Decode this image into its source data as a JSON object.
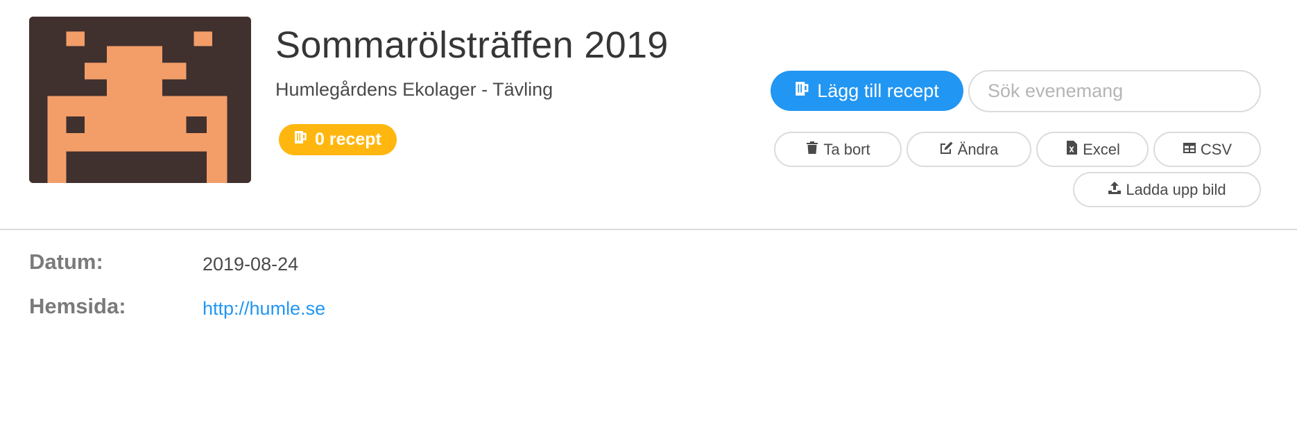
{
  "event": {
    "title": "Sommarölsträffen 2019",
    "subtitle": "Humlegårdens Ekolager - Tävling",
    "recipe_count": "0 recept"
  },
  "actions": {
    "add_recipe": "Lägg till recept",
    "search_placeholder": "Sök evenemang",
    "delete": "Ta bort",
    "edit": "Ändra",
    "excel": "Excel",
    "csv": "CSV",
    "upload_image": "Ladda upp bild"
  },
  "details": {
    "date_label": "Datum:",
    "date_value": "2019-08-24",
    "website_label": "Hemsida:",
    "website_value": "http://humle.se"
  },
  "icons": {
    "badge": "beer-mug-icon",
    "add_recipe": "beer-mug-icon",
    "delete": "trash-icon",
    "edit": "edit-icon",
    "excel": "excel-file-icon",
    "csv": "table-icon",
    "upload": "upload-icon"
  },
  "colors": {
    "primary": "#2196f3",
    "badge": "#ffb70f",
    "avatar_bg": "#40302e",
    "avatar_fg": "#f39e68"
  }
}
